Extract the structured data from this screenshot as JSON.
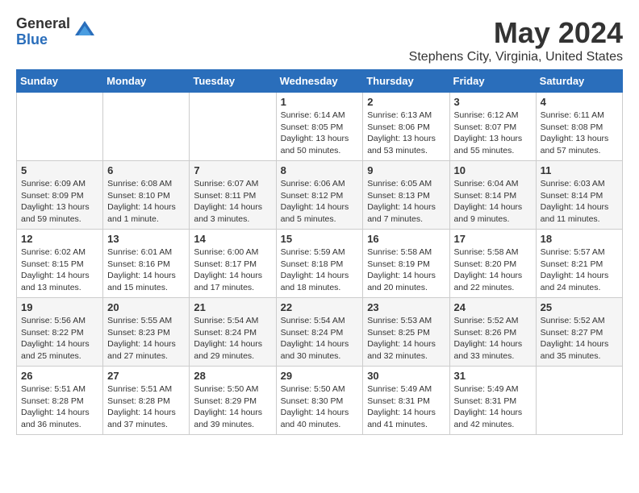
{
  "logo": {
    "general": "General",
    "blue": "Blue"
  },
  "title": "May 2024",
  "subtitle": "Stephens City, Virginia, United States",
  "days_of_week": [
    "Sunday",
    "Monday",
    "Tuesday",
    "Wednesday",
    "Thursday",
    "Friday",
    "Saturday"
  ],
  "weeks": [
    [
      {
        "day": "",
        "info": ""
      },
      {
        "day": "",
        "info": ""
      },
      {
        "day": "",
        "info": ""
      },
      {
        "day": "1",
        "info": "Sunrise: 6:14 AM\nSunset: 8:05 PM\nDaylight: 13 hours\nand 50 minutes."
      },
      {
        "day": "2",
        "info": "Sunrise: 6:13 AM\nSunset: 8:06 PM\nDaylight: 13 hours\nand 53 minutes."
      },
      {
        "day": "3",
        "info": "Sunrise: 6:12 AM\nSunset: 8:07 PM\nDaylight: 13 hours\nand 55 minutes."
      },
      {
        "day": "4",
        "info": "Sunrise: 6:11 AM\nSunset: 8:08 PM\nDaylight: 13 hours\nand 57 minutes."
      }
    ],
    [
      {
        "day": "5",
        "info": "Sunrise: 6:09 AM\nSunset: 8:09 PM\nDaylight: 13 hours\nand 59 minutes."
      },
      {
        "day": "6",
        "info": "Sunrise: 6:08 AM\nSunset: 8:10 PM\nDaylight: 14 hours\nand 1 minute."
      },
      {
        "day": "7",
        "info": "Sunrise: 6:07 AM\nSunset: 8:11 PM\nDaylight: 14 hours\nand 3 minutes."
      },
      {
        "day": "8",
        "info": "Sunrise: 6:06 AM\nSunset: 8:12 PM\nDaylight: 14 hours\nand 5 minutes."
      },
      {
        "day": "9",
        "info": "Sunrise: 6:05 AM\nSunset: 8:13 PM\nDaylight: 14 hours\nand 7 minutes."
      },
      {
        "day": "10",
        "info": "Sunrise: 6:04 AM\nSunset: 8:14 PM\nDaylight: 14 hours\nand 9 minutes."
      },
      {
        "day": "11",
        "info": "Sunrise: 6:03 AM\nSunset: 8:14 PM\nDaylight: 14 hours\nand 11 minutes."
      }
    ],
    [
      {
        "day": "12",
        "info": "Sunrise: 6:02 AM\nSunset: 8:15 PM\nDaylight: 14 hours\nand 13 minutes."
      },
      {
        "day": "13",
        "info": "Sunrise: 6:01 AM\nSunset: 8:16 PM\nDaylight: 14 hours\nand 15 minutes."
      },
      {
        "day": "14",
        "info": "Sunrise: 6:00 AM\nSunset: 8:17 PM\nDaylight: 14 hours\nand 17 minutes."
      },
      {
        "day": "15",
        "info": "Sunrise: 5:59 AM\nSunset: 8:18 PM\nDaylight: 14 hours\nand 18 minutes."
      },
      {
        "day": "16",
        "info": "Sunrise: 5:58 AM\nSunset: 8:19 PM\nDaylight: 14 hours\nand 20 minutes."
      },
      {
        "day": "17",
        "info": "Sunrise: 5:58 AM\nSunset: 8:20 PM\nDaylight: 14 hours\nand 22 minutes."
      },
      {
        "day": "18",
        "info": "Sunrise: 5:57 AM\nSunset: 8:21 PM\nDaylight: 14 hours\nand 24 minutes."
      }
    ],
    [
      {
        "day": "19",
        "info": "Sunrise: 5:56 AM\nSunset: 8:22 PM\nDaylight: 14 hours\nand 25 minutes."
      },
      {
        "day": "20",
        "info": "Sunrise: 5:55 AM\nSunset: 8:23 PM\nDaylight: 14 hours\nand 27 minutes."
      },
      {
        "day": "21",
        "info": "Sunrise: 5:54 AM\nSunset: 8:24 PM\nDaylight: 14 hours\nand 29 minutes."
      },
      {
        "day": "22",
        "info": "Sunrise: 5:54 AM\nSunset: 8:24 PM\nDaylight: 14 hours\nand 30 minutes."
      },
      {
        "day": "23",
        "info": "Sunrise: 5:53 AM\nSunset: 8:25 PM\nDaylight: 14 hours\nand 32 minutes."
      },
      {
        "day": "24",
        "info": "Sunrise: 5:52 AM\nSunset: 8:26 PM\nDaylight: 14 hours\nand 33 minutes."
      },
      {
        "day": "25",
        "info": "Sunrise: 5:52 AM\nSunset: 8:27 PM\nDaylight: 14 hours\nand 35 minutes."
      }
    ],
    [
      {
        "day": "26",
        "info": "Sunrise: 5:51 AM\nSunset: 8:28 PM\nDaylight: 14 hours\nand 36 minutes."
      },
      {
        "day": "27",
        "info": "Sunrise: 5:51 AM\nSunset: 8:28 PM\nDaylight: 14 hours\nand 37 minutes."
      },
      {
        "day": "28",
        "info": "Sunrise: 5:50 AM\nSunset: 8:29 PM\nDaylight: 14 hours\nand 39 minutes."
      },
      {
        "day": "29",
        "info": "Sunrise: 5:50 AM\nSunset: 8:30 PM\nDaylight: 14 hours\nand 40 minutes."
      },
      {
        "day": "30",
        "info": "Sunrise: 5:49 AM\nSunset: 8:31 PM\nDaylight: 14 hours\nand 41 minutes."
      },
      {
        "day": "31",
        "info": "Sunrise: 5:49 AM\nSunset: 8:31 PM\nDaylight: 14 hours\nand 42 minutes."
      },
      {
        "day": "",
        "info": ""
      }
    ]
  ]
}
